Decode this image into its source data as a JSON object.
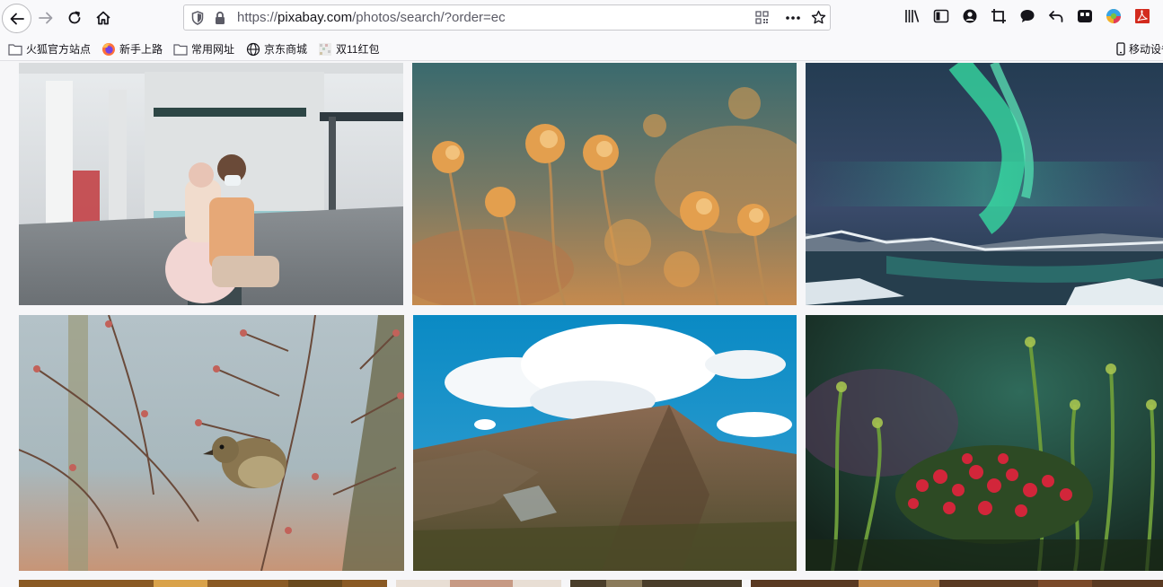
{
  "browser": {
    "url_prefix": "https://",
    "url_host": "pixabay.com",
    "url_path": "/photos/search/?order=ec"
  },
  "bookmarks": [
    {
      "label": "火狐官方站点",
      "icon": "folder-icon"
    },
    {
      "label": "新手上路",
      "icon": "firefox-icon"
    },
    {
      "label": "常用网址",
      "icon": "folder-icon"
    },
    {
      "label": "京东商城",
      "icon": "globe-icon"
    },
    {
      "label": "双11红包",
      "icon": "image-icon"
    },
    {
      "label": "移动设备",
      "icon": "mobile-icon"
    }
  ],
  "photos": [
    {
      "subject": "couple-in-subway-station"
    },
    {
      "subject": "dried-flowers"
    },
    {
      "subject": "aurora-over-lake"
    },
    {
      "subject": "bird-on-branch"
    },
    {
      "subject": "mountain-and-clouds"
    },
    {
      "subject": "red-berries-heather"
    },
    {
      "subject": "autumn-trees"
    },
    {
      "subject": "portrait"
    },
    {
      "subject": "forest"
    },
    {
      "subject": "landscape"
    }
  ],
  "colors": {
    "toolbar_bg": "#f9f9fb",
    "page_bg": "#f6f6f8"
  }
}
